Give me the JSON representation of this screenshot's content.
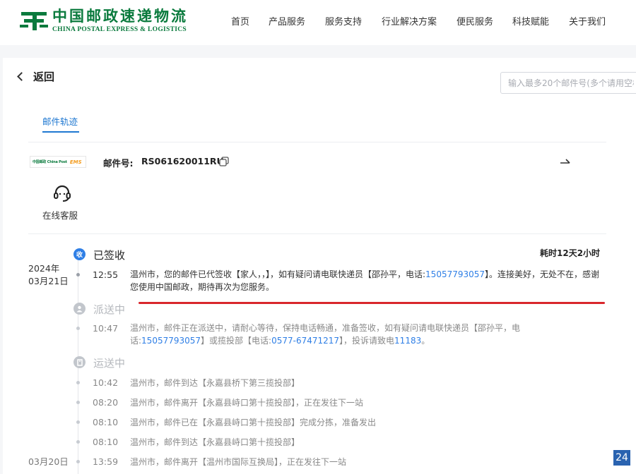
{
  "header": {
    "logo_cn": "中国邮政速递物流",
    "logo_en": "CHINA POSTAL EXPRESS & LOGISTICS",
    "nav": [
      "首页",
      "产品服务",
      "服务支持",
      "行业解决方案",
      "便民服务",
      "科技赋能",
      "关于我们"
    ]
  },
  "page": {
    "back_label": "返回",
    "search_placeholder": "输入最多20个邮件号(多个请用空格",
    "tab_label": "邮件轨迹"
  },
  "mail": {
    "brand_cn": "中国邮政 China Post",
    "brand_ems": "EMS",
    "number_label": "邮件号:",
    "number": "RS061620011RU",
    "customer_service": "在线客服",
    "duration": "耗时12天2小时"
  },
  "timeline": {
    "signed": {
      "status": "已签收",
      "icon": "收",
      "date_year": "2024年",
      "date_day": "03月21日",
      "time": "12:55",
      "text_before": "温州市，您的邮件已代签收【家人，，】，如有疑问请电联快递员【邵孙平，电话:",
      "phone": "15057793057",
      "text_after": "】。连接美好，无处不在，感谢您使用中国邮政，期待再次为您服务。"
    },
    "delivering": {
      "status": "派送中",
      "time": "10:47",
      "text_1": "温州市，邮件正在派送中，请耐心等待，保持电话畅通，准备签收，如有疑问请电联快递员【邵孙平，电话:",
      "phone_1": "15057793057",
      "text_2": "】或揽投部【电话:",
      "phone_2": "0577-67471217",
      "text_3": "】，投诉请致电",
      "phone_3": "11183",
      "text_4": "。"
    },
    "transit": {
      "status": "运送中",
      "events": [
        {
          "time": "10:42",
          "text": "温州市，邮件到达【永嘉县桥下第三揽投部】"
        },
        {
          "time": "08:20",
          "text": "温州市，邮件离开【永嘉县峙口第十揽投部】，正在发往下一站"
        },
        {
          "time": "08:10",
          "text": "温州市，邮件已在【永嘉县峙口第十揽投部】完成分拣，准备发出"
        },
        {
          "time": "08:10",
          "text": "温州市，邮件到达【永嘉县峙口第十揽投部】"
        },
        {
          "date": "03月20日",
          "time": "13:59",
          "text": "温州市，邮件离开【温州市国际互换局】，正在发往下一站"
        }
      ]
    }
  },
  "page_badge": "24",
  "colors": {
    "brand_green": "#0a7a3d",
    "accent_blue": "#2f7fe6",
    "annotation_red": "#d9262c"
  }
}
